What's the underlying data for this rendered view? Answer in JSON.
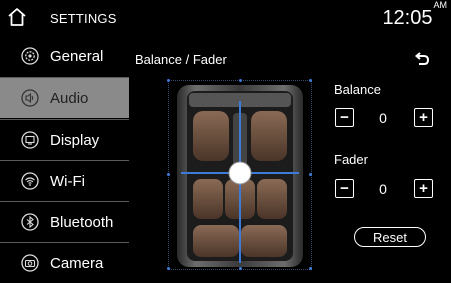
{
  "header": {
    "title": "SETTINGS",
    "time": "12:05",
    "ampm": "AM"
  },
  "sidebar": {
    "items": [
      {
        "label": "General",
        "icon": "gear-icon"
      },
      {
        "label": "Audio",
        "icon": "speaker-icon",
        "selected": true
      },
      {
        "label": "Display",
        "icon": "display-icon"
      },
      {
        "label": "Wi-Fi",
        "icon": "wifi-icon"
      },
      {
        "label": "Bluetooth",
        "icon": "bluetooth-icon"
      },
      {
        "label": "Camera",
        "icon": "camera-icon"
      }
    ]
  },
  "main": {
    "title": "Balance / Fader",
    "balance": {
      "label": "Balance",
      "value": "0",
      "minus": "−",
      "plus": "+"
    },
    "fader": {
      "label": "Fader",
      "value": "0",
      "minus": "−",
      "plus": "+"
    },
    "reset_label": "Reset"
  }
}
